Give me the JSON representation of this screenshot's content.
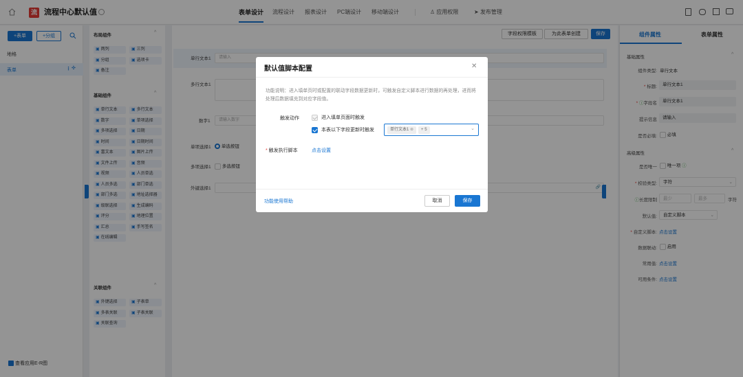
{
  "header": {
    "app_logo": "流",
    "app_title": "流程中心默认值",
    "tabs": [
      "表单设计",
      "流程设计",
      "报表设计",
      "PC端设计",
      "移动端设计"
    ],
    "perm": "应用权限",
    "publish": "发布管理"
  },
  "left": {
    "add_form": "+表单",
    "add_group": "+分组",
    "items": [
      "地格",
      "表单"
    ],
    "bottom_link": "查看应用E-R图"
  },
  "components": {
    "layout_title": "布局组件",
    "layout": [
      "两列",
      "三列",
      "分组",
      "选项卡",
      "备注"
    ],
    "basic_title": "基础组件",
    "basic": [
      "单行文本",
      "多行文本",
      "数字",
      "单项选择",
      "多项选择",
      "日期",
      "时间",
      "日期时间",
      "富文本",
      "图片上传",
      "文件上传",
      "音频",
      "视频",
      "人员单选",
      "人员多选",
      "部门单选",
      "部门多选",
      "地址选择器",
      "级联选择",
      "生成编码",
      "评分",
      "地理位置",
      "汇总",
      "手写签名",
      "在线编辑"
    ],
    "assoc_title": "关联组件",
    "assoc": [
      "外键选择",
      "子表单",
      "多表关联",
      "子表关联",
      "关联查询"
    ]
  },
  "toolbar": {
    "field_perm": "字段权限模板",
    "create_form": "为此表单创建",
    "save": "保存"
  },
  "canvas": {
    "f1_label": "单行文本1",
    "f1_ph": "请输入",
    "f2_label": "多行文本1",
    "f3_label": "数字1",
    "f3_ph": "请输入数字",
    "f4_label": "单项选择1",
    "f4_opt": "单选按钮",
    "f5_label": "多项选择1",
    "f5_opt": "多选按钮",
    "f6_label": "外键选择1"
  },
  "right": {
    "tab_comp": "组件属性",
    "tab_form": "表单属性",
    "basic_title": "基础属性",
    "type_label": "组件类型:",
    "type_value": "单行文本",
    "title_label": "标题:",
    "title_value": "单行文本1",
    "fieldname_label": "字段名",
    "fieldname_value": "单行文本1",
    "hint_label": "提示信息",
    "hint_value": "请输入",
    "required_label": "是否必填:",
    "required_opt": "必填",
    "adv_title": "高级属性",
    "unique_label": "是否唯一",
    "unique_opt": "唯一项",
    "validate_label": "校验类型:",
    "validate_value": "字符",
    "len_label": "长度限制",
    "len_min": "最少",
    "len_max": "最多",
    "len_unit": "字符",
    "default_label": "默认值:",
    "default_value": "自定义脚本",
    "script_label": "自定义脚本:",
    "script_link": "点击设置",
    "link_label": "数据联动:",
    "link_opt": "启用",
    "common_label": "常用值:",
    "common_link": "点击设置",
    "cond_label": "可用条件:",
    "cond_link": "点击设置"
  },
  "modal": {
    "title": "默认值脚本配置",
    "desc": "功能说明：进入填单页时或配置的联动字段数据更新时，可触发自定义脚本进行数据的再处理，进而将处理后数据填充到对应字段值。",
    "trigger_label": "触发动作",
    "opt1": "进入填单页面时触发",
    "opt2": "本表以下字段更新时触发",
    "tag1": "单行文本1",
    "tag_more": "+ 5",
    "script_label": "触发执行脚本",
    "script_link": "点击设置",
    "help": "功能使用帮助",
    "cancel": "取消",
    "save": "保存"
  }
}
